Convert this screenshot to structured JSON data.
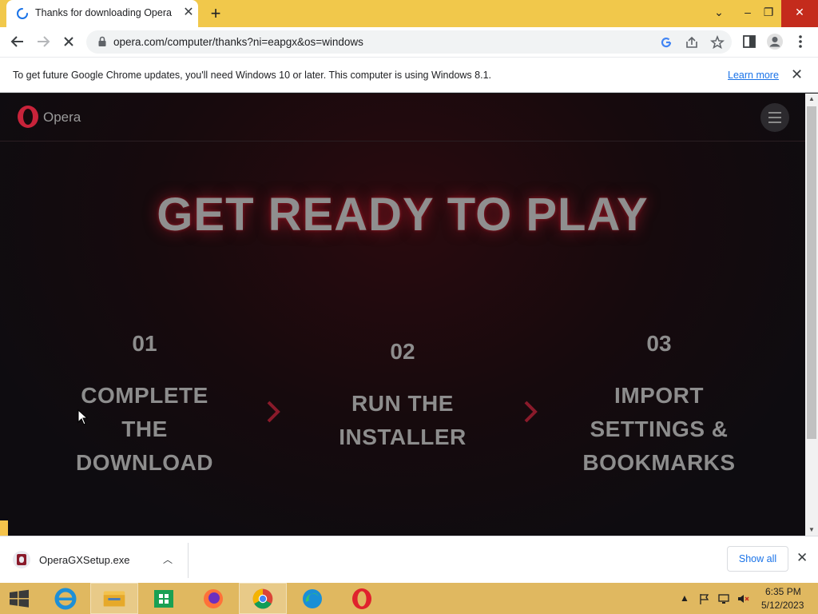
{
  "browser": {
    "tab_title": "Thanks for downloading Opera",
    "url": "opera.com/computer/thanks?ni=eapgx&os=windows"
  },
  "infobar": {
    "message": "To get future Google Chrome updates, you'll need Windows 10 or later. This computer is using Windows 8.1.",
    "learn_more": "Learn more"
  },
  "page": {
    "brand": "Opera",
    "headline": "GET READY TO PLAY",
    "steps": [
      {
        "num": "01",
        "label_lines": [
          "COMPLETE",
          "THE",
          "DOWNLOAD"
        ]
      },
      {
        "num": "02",
        "label_lines": [
          "RUN THE",
          "INSTALLER"
        ]
      },
      {
        "num": "03",
        "label_lines": [
          "IMPORT",
          "SETTINGS &",
          "BOOKMARKS"
        ]
      }
    ]
  },
  "download_shelf": {
    "file_name": "OperaGXSetup.exe",
    "show_all": "Show all"
  },
  "taskbar": {
    "time": "6:35 PM",
    "date": "5/12/2023"
  },
  "colors": {
    "tab_strip": "#f1c84b",
    "page_bg": "#160a0d",
    "accent_red": "#c8233a",
    "taskbar": "#e0b860",
    "link": "#1a73e8"
  }
}
